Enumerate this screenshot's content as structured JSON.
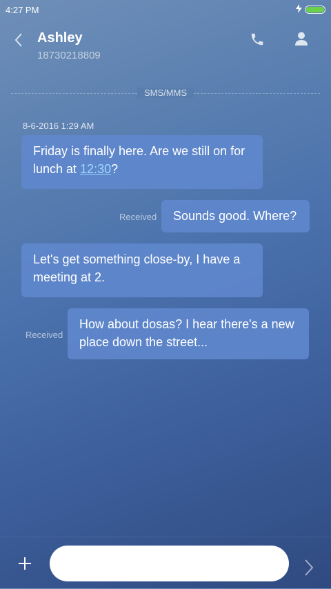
{
  "status_bar": {
    "time": "4:27 PM"
  },
  "header": {
    "contact_name": "Ashley",
    "contact_number": "18730218809"
  },
  "divider": {
    "label": "SMS/MMS"
  },
  "thread": {
    "timestamp": "8-6-2016 1:29 AM",
    "messages": [
      {
        "text_before": "Friday is finally here. Are we still on for lunch at ",
        "link": "12:30",
        "text_after": "?"
      },
      {
        "text": "Sounds good. Where?",
        "status": "Received"
      },
      {
        "text": "Let's get something close-by, I have a meeting at 2."
      },
      {
        "text": "How about dosas? I hear there's a new place down the street...",
        "status": "Received"
      }
    ]
  },
  "composer": {
    "input_value": ""
  },
  "colors": {
    "battery": "#6bd14a",
    "bubble": "#5f87cd",
    "link": "#9fd8ff"
  }
}
